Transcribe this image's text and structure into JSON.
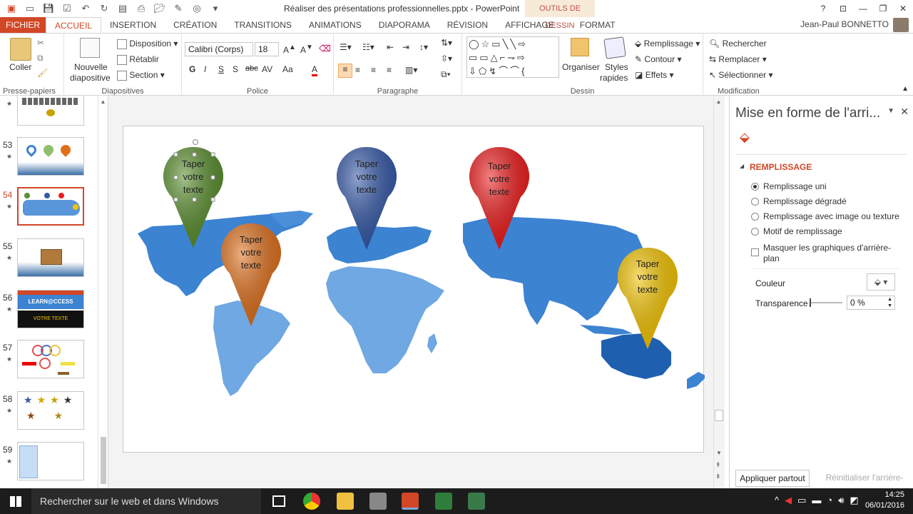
{
  "titlebar": {
    "doc_title": "Réaliser des présentations professionnelles.pptx - PowerPoint",
    "tools_label": "OUTILS DE DESSIN",
    "help": "?",
    "user": "Jean-Paul BONNETTO"
  },
  "tabs": {
    "file": "FICHIER",
    "items": [
      "ACCUEIL",
      "INSERTION",
      "CRÉATION",
      "TRANSITIONS",
      "ANIMATIONS",
      "DIAPORAMA",
      "RÉVISION",
      "AFFICHAGE",
      "FORMAT"
    ]
  },
  "ribbon": {
    "clipboard": {
      "paste": "Coller",
      "label": "Presse-papiers"
    },
    "slides": {
      "new_slide_1": "Nouvelle",
      "new_slide_2": "diapositive",
      "layout": "Disposition",
      "reset": "Rétablir",
      "section": "Section",
      "label": "Diapositives"
    },
    "font": {
      "name": "Calibri (Corps)",
      "size": "18",
      "bold": "G",
      "italic": "I",
      "underline": "S",
      "shadow": "S",
      "strike": "abc",
      "spacing": "AV",
      "case": "Aa",
      "color": "A",
      "label": "Police"
    },
    "paragraph": {
      "label": "Paragraphe"
    },
    "drawing": {
      "arrange": "Organiser",
      "styles_1": "Styles",
      "styles_2": "rapides",
      "fill": "Remplissage",
      "outline": "Contour",
      "effects": "Effets",
      "label": "Dessin"
    },
    "editing": {
      "find": "Rechercher",
      "replace": "Remplacer",
      "select": "Sélectionner",
      "label": "Modification"
    }
  },
  "thumbnails": [
    {
      "num": "53",
      "star": "★"
    },
    {
      "num": "54",
      "star": "★",
      "selected": true
    },
    {
      "num": "55",
      "star": "★"
    },
    {
      "num": "56",
      "star": "★",
      "banner_1": "LEARN@CCESS",
      "banner_2": "VOTRE TEXTE"
    },
    {
      "num": "57",
      "star": "★"
    },
    {
      "num": "58",
      "star": "★"
    },
    {
      "num": "59",
      "star": "★"
    }
  ],
  "slide": {
    "pins": [
      {
        "line1": "Taper",
        "line2": "votre",
        "line3": "texte",
        "color": "#5a8f2e"
      },
      {
        "line1": "Taper",
        "line2": "votre",
        "line3": "texte",
        "color": "#e0701c"
      },
      {
        "line1": "Taper",
        "line2": "votre",
        "line3": "texte",
        "color": "#3559a8"
      },
      {
        "line1": "Taper",
        "line2": "votre",
        "line3": "texte",
        "color": "#ef1c1c"
      },
      {
        "line1": "Taper",
        "line2": "votre",
        "line3": "texte",
        "color": "#f4c400"
      }
    ],
    "map_color": "#3c83d2"
  },
  "pane": {
    "title": "Mise en forme de l'arri...",
    "section": "REMPLISSAGE",
    "options": [
      "Remplissage uni",
      "Remplissage dégradé",
      "Remplissage avec image ou texture",
      "Motif de remplissage"
    ],
    "hide_bg_1": "Masquer les graphiques d'arrière-",
    "hide_bg_2": "plan",
    "color_label": "Couleur",
    "transparency_label": "Transparence",
    "transparency_value": "0 %",
    "apply_all": "Appliquer partout",
    "reset_bg": "Réinitialiser l'arrière-plan"
  },
  "taskbar": {
    "search": "Rechercher sur le web et dans Windows",
    "time": "14:25",
    "date": "06/01/2016"
  },
  "colors": {
    "accent": "#d24726"
  }
}
